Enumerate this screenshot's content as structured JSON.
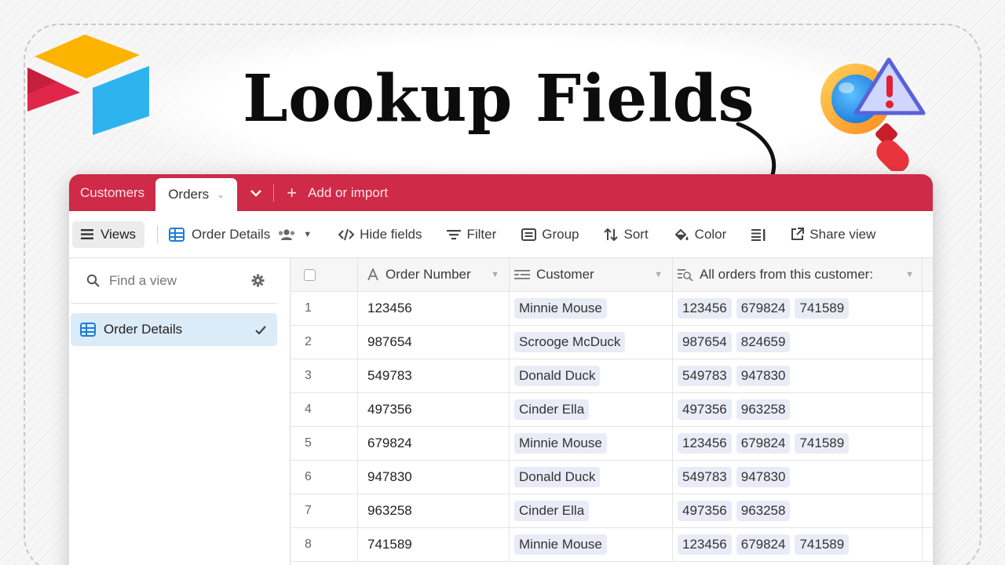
{
  "headline": "Lookup Fields",
  "tabs": {
    "customers": "Customers",
    "orders": "Orders",
    "add": "Add or import"
  },
  "toolbar": {
    "views": "Views",
    "view_name": "Order Details",
    "hide_fields": "Hide fields",
    "filter": "Filter",
    "group": "Group",
    "sort": "Sort",
    "color": "Color",
    "share_view": "Share view"
  },
  "sidebar": {
    "search_placeholder": "Find a view",
    "views": [
      {
        "label": "Order Details"
      }
    ]
  },
  "grid": {
    "columns": {
      "order_number": "Order Number",
      "customer": "Customer",
      "all_orders": "All orders from this customer:"
    },
    "rows": [
      {
        "n": "1",
        "order": "123456",
        "customer": "Minnie Mouse",
        "all": [
          "123456",
          "679824",
          "741589"
        ]
      },
      {
        "n": "2",
        "order": "987654",
        "customer": "Scrooge McDuck",
        "all": [
          "987654",
          "824659"
        ]
      },
      {
        "n": "3",
        "order": "549783",
        "customer": "Donald Duck",
        "all": [
          "549783",
          "947830"
        ]
      },
      {
        "n": "4",
        "order": "497356",
        "customer": "Cinder Ella",
        "all": [
          "497356",
          "963258"
        ]
      },
      {
        "n": "5",
        "order": "679824",
        "customer": "Minnie Mouse",
        "all": [
          "123456",
          "679824",
          "741589"
        ]
      },
      {
        "n": "6",
        "order": "947830",
        "customer": "Donald Duck",
        "all": [
          "549783",
          "947830"
        ]
      },
      {
        "n": "7",
        "order": "963258",
        "customer": "Cinder Ella",
        "all": [
          "497356",
          "963258"
        ]
      },
      {
        "n": "8",
        "order": "741589",
        "customer": "Minnie Mouse",
        "all": [
          "123456",
          "679824",
          "741589"
        ]
      }
    ]
  },
  "colors": {
    "tab_bar": "#cf2a48",
    "selected_view": "#dcebf8",
    "chip": "#e9ecf6",
    "logo_yellow": "#fcb400",
    "logo_red": "#e0264a",
    "logo_blue": "#2db4ef"
  }
}
